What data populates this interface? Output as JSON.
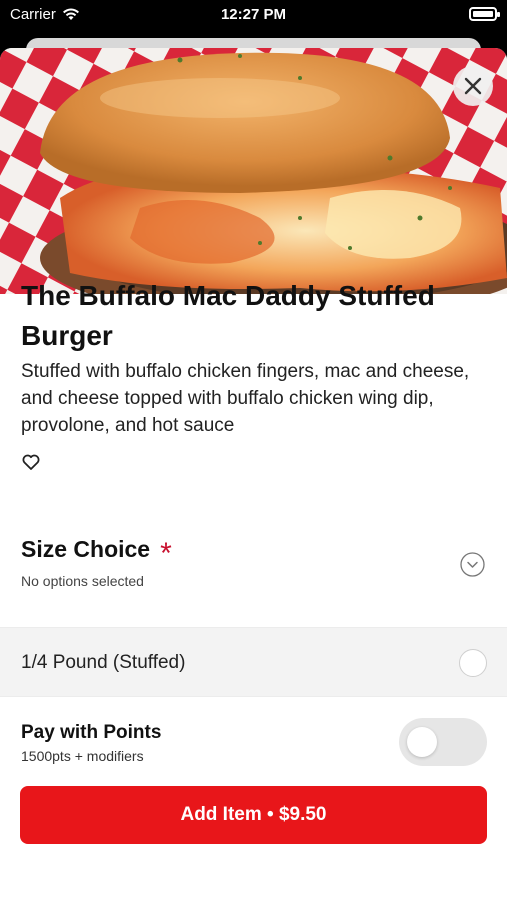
{
  "status_bar": {
    "carrier": "Carrier",
    "time": "12:27 PM"
  },
  "item": {
    "title": "The Buffalo Mac Daddy Stuffed Burger",
    "description": "Stuffed with buffalo chicken fingers, mac and cheese, and cheese topped with buffalo chicken wing dip, provolone, and hot sauce",
    "image_icon": "burger-photo"
  },
  "size_choice": {
    "title": "Size Choice",
    "required_mark": "*",
    "subtitle": "No options selected",
    "options": [
      {
        "label": "1/4 Pound (Stuffed)",
        "selected": false
      }
    ]
  },
  "points": {
    "title": "Pay with Points",
    "subtitle": "1500pts + modifiers",
    "enabled": false
  },
  "add_button": {
    "label": "Add Item • $9.50"
  },
  "colors": {
    "accent": "#e8161a",
    "required": "#c8102e"
  }
}
